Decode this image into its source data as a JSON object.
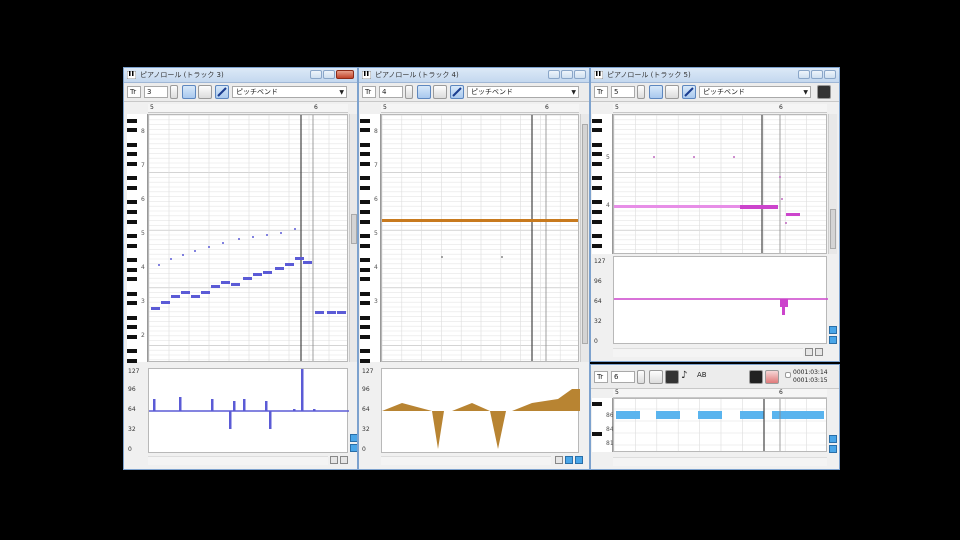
{
  "windows": [
    {
      "title": "ピアノロール (トラック 3)",
      "track_label": "Tr",
      "track_value": "3",
      "param": "ピッチベンド",
      "ruler_marks": [
        "5",
        "6"
      ],
      "key_labels": [
        "8",
        "7",
        "6",
        "5",
        "4",
        "3",
        "2"
      ],
      "lane_labels": [
        "127",
        "96",
        "64",
        "32",
        "0"
      ],
      "note_color": "#5b5bd6"
    },
    {
      "title": "ピアノロール (トラック 4)",
      "track_label": "Tr",
      "track_value": "4",
      "param": "ピッチベンド",
      "ruler_marks": [
        "5",
        "6"
      ],
      "key_labels": [
        "8",
        "7",
        "6",
        "5",
        "4",
        "3"
      ],
      "lane_labels": [
        "127",
        "96",
        "64",
        "32",
        "0"
      ],
      "note_color": "#c87a1e"
    },
    {
      "title": "ピアノロール (トラック 5)",
      "track_label": "Tr",
      "track_value": "5",
      "param": "ピッチベンド",
      "ruler_marks": [
        "5",
        "6"
      ],
      "key_labels": [
        "5",
        "4"
      ],
      "lane_labels": [
        "127",
        "96",
        "64",
        "32",
        "0"
      ],
      "note_color": "#cc44cc"
    }
  ],
  "drum": {
    "track_label": "Tr",
    "track_value": "6",
    "display_text": "AB",
    "time_top": "0001:03:14",
    "time_bottom": "0001:03:15",
    "ruler_marks": [
      "5",
      "6"
    ],
    "row_labels": [
      "86",
      "84",
      "81"
    ]
  },
  "colors": {
    "title_bar": "#c4d8ef",
    "drum_note": "#5ab4ee",
    "pitch_bar": "#b88432"
  }
}
